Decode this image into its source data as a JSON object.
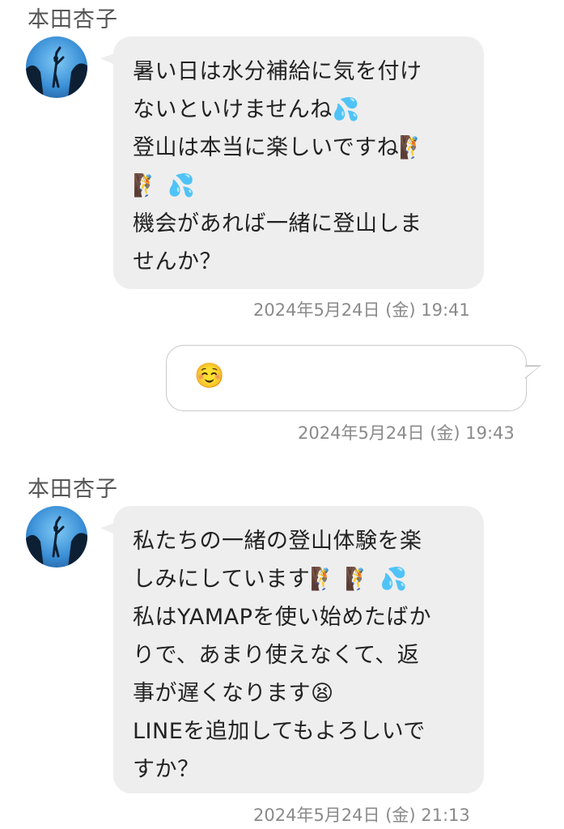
{
  "messages": [
    {
      "sender": "本田杏子",
      "lines": [
        "暑い日は水分補給に気を付け",
        "ないといけませんね💦",
        "登山は本当に楽しいですね🧗",
        "🧗 💦",
        "機会があれば一緒に登山しま",
        "せんか？"
      ],
      "time": "2024年5月24日 (金) 19:41"
    },
    {
      "lines": [
        "☺️"
      ],
      "time": "2024年5月24日 (金) 19:43"
    },
    {
      "sender": "本田杏子",
      "lines": [
        "私たちの一緒の登山体験を楽",
        "しみにしています🧗 🧗 💦",
        "私はYAMAPを使い始めたばか",
        "りで、あまり使えなくて、返",
        "事が遅くなります😫",
        "LINEを追加してもよろしいで",
        "すか？"
      ],
      "time": "2024年5月24日 (金) 21:13"
    }
  ]
}
